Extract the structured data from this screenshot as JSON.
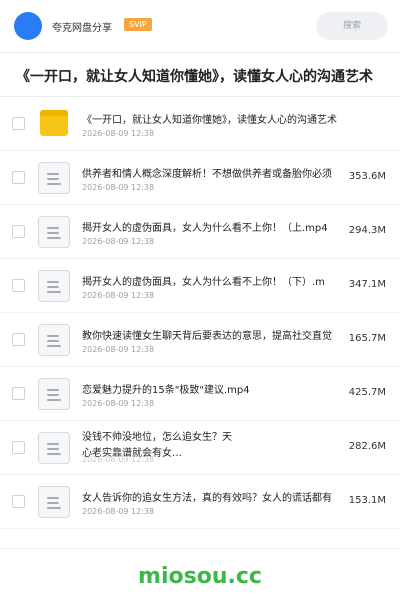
{
  "header": {
    "username": "夸克网盘分享",
    "badge": "SVIP",
    "search_placeholder": "搜索",
    "accent_color": "#2a7bf6",
    "badge_color": "#f7a43a"
  },
  "page_title": "《一开口，就让女人知道你懂她》，读懂女人心的沟通艺术",
  "files": [
    {
      "type": "folder",
      "icon": "folder-icon",
      "name": "《一开口，就让女人知道你懂她》，读懂女人心的沟通艺术",
      "date": "2026-08-09 12:38",
      "size": ""
    },
    {
      "type": "file",
      "icon": "document-icon",
      "name": "供养者和情人概念深度解析！不想做供养者或备胎你必须",
      "date": "2026-08-09 12:38",
      "size": "353.6M"
    },
    {
      "type": "file",
      "icon": "document-icon",
      "name": "揭开女人的虚伪面具，女人为什么看不上你！（上.mp4",
      "date": "2026-08-09 12:38",
      "size": "294.3M"
    },
    {
      "type": "file",
      "icon": "document-icon",
      "name": "揭开女人的虚伪面具，女人为什么看不上你！（下）.m",
      "date": "2026-08-09 12:38",
      "size": "347.1M"
    },
    {
      "type": "file",
      "icon": "document-icon",
      "name": "教你快速读懂女生聊天背后要表达的意思，提高社交直觉",
      "date": "2026-08-09 12:38",
      "size": "165.7M"
    },
    {
      "type": "file",
      "icon": "document-icon",
      "name": "恋爱魅力提升的15条\"极致\"建议.mp4",
      "date": "2026-08-09 12:38",
      "size": "425.7M"
    },
    {
      "type": "file",
      "icon": "document-icon",
      "name": "没钱不帅没地位，怎么追女生？天心老实靠谱就会有女…",
      "date": "2026-08-09 12:38",
      "size": "282.6M"
    },
    {
      "type": "file",
      "icon": "document-icon",
      "name": "女人告诉你的追女生方法，真的有效吗？女人的谎话都有",
      "date": "2026-08-09 12:38",
      "size": "153.1M"
    }
  ],
  "watermark": "miosou.cc"
}
